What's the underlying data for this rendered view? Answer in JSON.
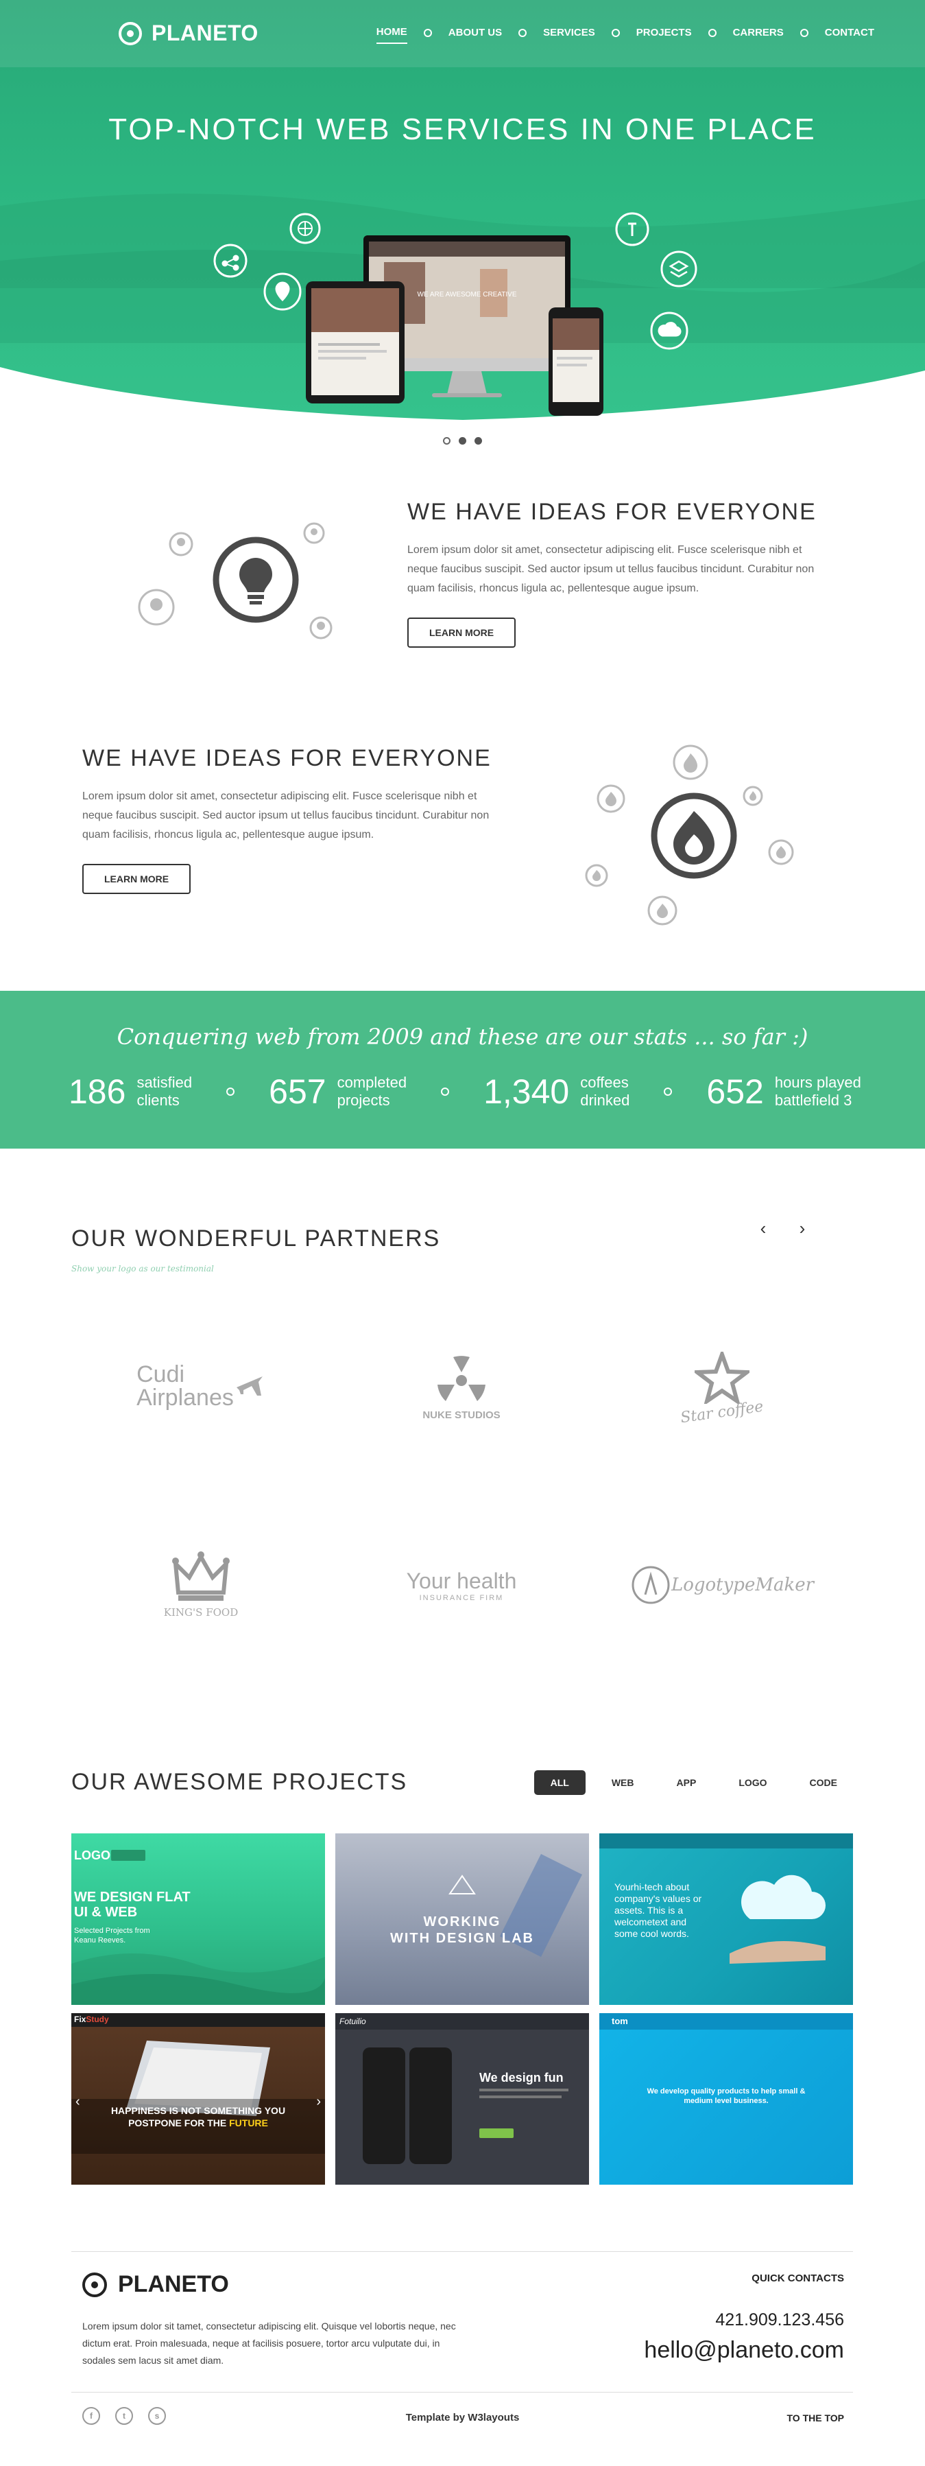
{
  "brand": {
    "name": "PLANETO"
  },
  "nav": {
    "items": [
      {
        "label": "HOME",
        "active": true
      },
      {
        "label": "ABOUT US"
      },
      {
        "label": "SERVICES"
      },
      {
        "label": "PROJECTS"
      },
      {
        "label": "CARRERS"
      },
      {
        "label": "CONTACT"
      }
    ]
  },
  "hero": {
    "title": "TOP-NOTCH WEB SERVICES IN ONE PLACE",
    "background_color": "#2db882",
    "slider_dots": 3,
    "active_dot": 2,
    "devices": {
      "monitor_text": "WE ARE AWESOME CREATIVE"
    },
    "icons": [
      "share-icon",
      "globe-icon",
      "pin-icon",
      "info-icon",
      "layers-icon",
      "cloud-icon"
    ]
  },
  "feature1": {
    "title": "WE HAVE IDEAS FOR EVERYONE",
    "text": "Lorem ipsum dolor sit amet, consectetur adipiscing elit. Fusce scelerisque nibh et neque faucibus suscipit. Sed auctor ipsum ut tellus faucibus tincidunt. Curabitur non quam facilisis, rhoncus ligula ac, pellentesque augue ipsum.",
    "button": "LEARN MORE",
    "icon": "lightbulb-icon"
  },
  "feature2": {
    "title": "WE HAVE IDEAS FOR EVERYONE",
    "text": "Lorem ipsum dolor sit amet, consectetur adipiscing elit. Fusce scelerisque nibh et neque faucibus suscipit. Sed auctor ipsum ut tellus faucibus tincidunt. Curabitur non quam facilisis, rhoncus ligula ac, pellentesque augue ipsum.",
    "button": "LEARN MORE",
    "icon": "flame-icon"
  },
  "stats": {
    "tagline": "Conquering web from 2009 and these are our stats ... so far :)",
    "color": "#4bbc89",
    "items": [
      {
        "num": "186",
        "l1": "satisfied",
        "l2": "clients"
      },
      {
        "num": "657",
        "l1": "completed",
        "l2": "projects"
      },
      {
        "num": "1,340",
        "l1": "coffees",
        "l2": "drinked"
      },
      {
        "num": "652",
        "l1": "hours played",
        "l2": "battlefield 3"
      }
    ]
  },
  "partners": {
    "title": "OUR WONDERFUL PARTNERS",
    "subtitle": "Show your logo as our testimonial",
    "logos": [
      {
        "l1": "Cudi",
        "l2": "Airplanes"
      },
      {
        "l1": "NUKE STUDIOS"
      },
      {
        "l1": "Star coffee"
      },
      {
        "l1": "KING'S FOOD"
      },
      {
        "l1": "Your health",
        "l2": "INSURANCE FIRM"
      },
      {
        "l1": "LogotypeMaker"
      }
    ]
  },
  "projects": {
    "title": "OUR AWESOME PROJECTS",
    "filters": [
      "ALL",
      "WEB",
      "APP",
      "LOGO",
      "CODE"
    ],
    "active_filter": "ALL",
    "tiles": [
      {
        "logo": "LOGO",
        "l1": "WE DESIGN FLAT",
        "l2": "UI & WEB",
        "l3": "Selected Projects from",
        "l4": "Keanu Reeves."
      },
      {
        "l1": "WORKING",
        "l2": "WITH DESIGN LAB"
      },
      {
        "l1": "Yourhi-tech about",
        "l2": "company's values or",
        "l3": "assets. This is a",
        "l4": "welcometext and",
        "l5": "some cool words."
      },
      {
        "brand": "Fix",
        "brand2": "Study",
        "l1": "HAPPINESS IS NOT SOMETHING YOU",
        "l2": "POSTPONE FOR THE",
        "l3": "FUTURE"
      },
      {
        "brand": "Fotuilio",
        "l1": "We design fun"
      },
      {
        "brand": "tom",
        "l1": "We develop quality products to help small &",
        "l2": "medium level business."
      }
    ]
  },
  "footer": {
    "description": "Lorem ipsum dolor sit tamet, consectetur adipiscing elit. Quisque vel lobortis neque, nec dictum erat. Proin malesuada, neque at facilisis posuere, tortor arcu vulputate dui, in sodales sem lacus sit amet diam.",
    "quick_contacts": "QUICK CONTACTS",
    "phone": "421.909.123.456",
    "email": "hello@planeto.com",
    "credit": "Template by W3layouts",
    "to_top": "TO THE TOP",
    "socials": [
      "facebook-icon",
      "twitter-icon",
      "skype-icon"
    ]
  }
}
